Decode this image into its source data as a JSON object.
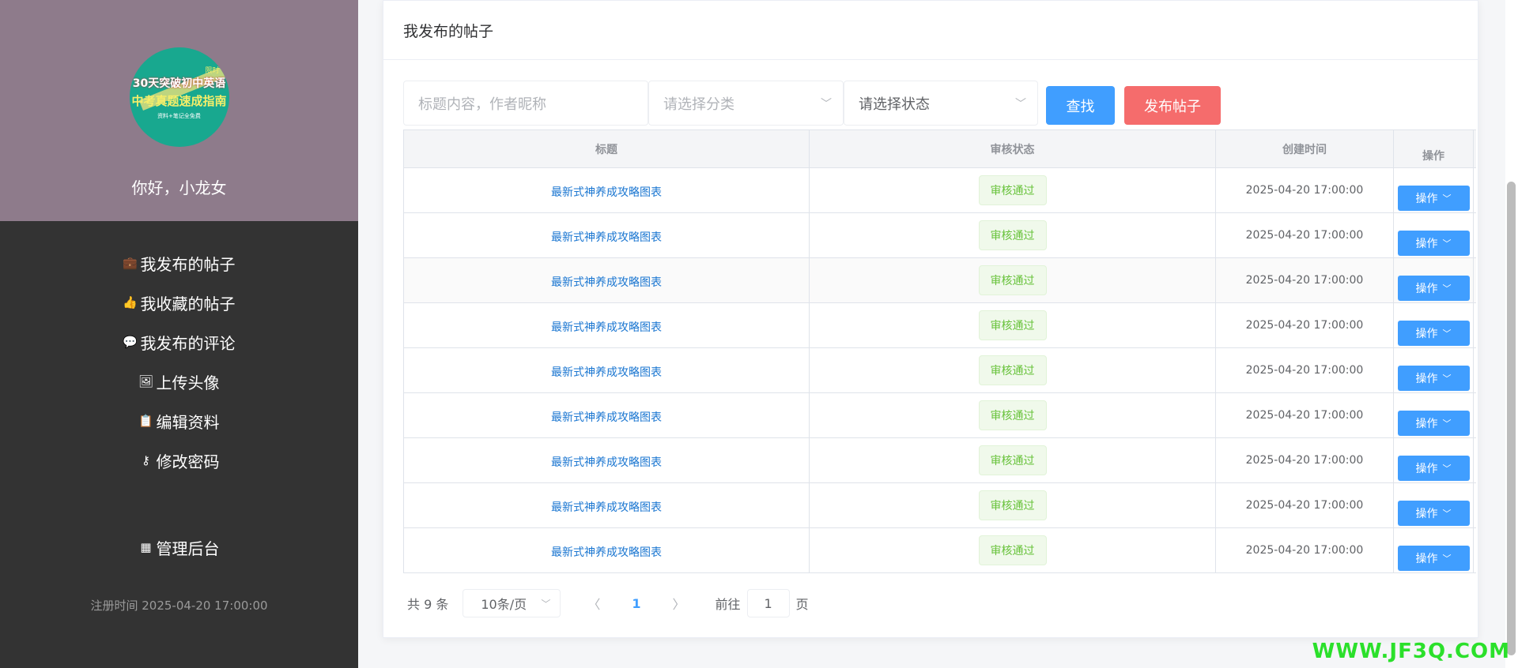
{
  "sidebar": {
    "avatar": {
      "line0": "限时",
      "line1": "30天突破初中英语",
      "line2": "中考真题速成指南",
      "line3": "资料+笔记全免费"
    },
    "greeting": "你好，小龙女",
    "menu": [
      {
        "icon": "briefcase-icon",
        "glyph": "💼",
        "label": "我发布的帖子"
      },
      {
        "icon": "thumbs-up-icon",
        "glyph": "👍",
        "label": "我收藏的帖子"
      },
      {
        "icon": "comment-icon",
        "glyph": "💬",
        "label": "我发布的评论"
      },
      {
        "icon": "image-icon",
        "glyph": "🖼",
        "label": "上传头像"
      },
      {
        "icon": "clipboard-icon",
        "glyph": "📋",
        "label": "编辑资料"
      },
      {
        "icon": "key-icon",
        "glyph": "⚷",
        "label": "修改密码"
      },
      {
        "icon": "grid-icon",
        "glyph": "▦",
        "label": "管理后台"
      }
    ],
    "register_label": "注册时间",
    "register_time": "2025-04-20 17:00:00"
  },
  "card": {
    "title": "我发布的帖子"
  },
  "filters": {
    "keyword_placeholder": "标题内容，作者昵称",
    "category_placeholder": "请选择分类",
    "status_placeholder": "请选择状态",
    "search_label": "查找",
    "publish_label": "发布帖子"
  },
  "table": {
    "headers": [
      "标题",
      "审核状态",
      "创建时间",
      "操作"
    ],
    "rows": [
      {
        "title": "最新式神养成攻略图表",
        "status": "审核通过",
        "created": "2025-04-20 17:00:00",
        "action": "操作"
      },
      {
        "title": "最新式神养成攻略图表",
        "status": "审核通过",
        "created": "2025-04-20 17:00:00",
        "action": "操作"
      },
      {
        "title": "最新式神养成攻略图表",
        "status": "审核通过",
        "created": "2025-04-20 17:00:00",
        "action": "操作"
      },
      {
        "title": "最新式神养成攻略图表",
        "status": "审核通过",
        "created": "2025-04-20 17:00:00",
        "action": "操作"
      },
      {
        "title": "最新式神养成攻略图表",
        "status": "审核通过",
        "created": "2025-04-20 17:00:00",
        "action": "操作"
      },
      {
        "title": "最新式神养成攻略图表",
        "status": "审核通过",
        "created": "2025-04-20 17:00:00",
        "action": "操作"
      },
      {
        "title": "最新式神养成攻略图表",
        "status": "审核通过",
        "created": "2025-04-20 17:00:00",
        "action": "操作"
      },
      {
        "title": "最新式神养成攻略图表",
        "status": "审核通过",
        "created": "2025-04-20 17:00:00",
        "action": "操作"
      },
      {
        "title": "最新式神养成攻略图表",
        "status": "审核通过",
        "created": "2025-04-20 17:00:00",
        "action": "操作"
      }
    ]
  },
  "pagination": {
    "total": "共 9 条",
    "page_size": "10条/页",
    "current_page": "1",
    "goto_label": "前往",
    "goto_value": "1",
    "page_unit": "页"
  },
  "watermark": "WWW.JF3Q.COM"
}
